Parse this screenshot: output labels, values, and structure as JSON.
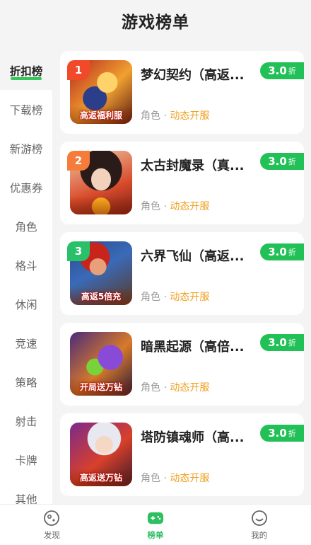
{
  "header": {
    "title": "游戏榜单"
  },
  "sidebar": {
    "items": [
      {
        "label": "折扣榜",
        "active": true
      },
      {
        "label": "下载榜"
      },
      {
        "label": "新游榜"
      },
      {
        "label": "优惠券"
      },
      {
        "label": "角色"
      },
      {
        "label": "格斗"
      },
      {
        "label": "休闲"
      },
      {
        "label": "竞速"
      },
      {
        "label": "策略"
      },
      {
        "label": "射击"
      },
      {
        "label": "卡牌"
      },
      {
        "label": "其他"
      }
    ]
  },
  "games": [
    {
      "rank": "1",
      "name": "梦幻契约（高返...",
      "category": "角色",
      "tag": "动态开服",
      "discount": "3.0",
      "unit": "折",
      "banner": "高返福利服",
      "rank_color": "#f04a2a"
    },
    {
      "rank": "2",
      "name": "太古封魔录（真...",
      "category": "角色",
      "tag": "动态开服",
      "discount": "3.0",
      "unit": "折",
      "banner": "",
      "rank_color": "#f57c3a"
    },
    {
      "rank": "3",
      "name": "六界飞仙（高返...",
      "category": "角色",
      "tag": "动态开服",
      "discount": "3.0",
      "unit": "折",
      "banner": "高返5倍充",
      "rank_color": "#29c06a"
    },
    {
      "rank": "",
      "name": "暗黑起源（高倍...",
      "category": "角色",
      "tag": "动态开服",
      "discount": "3.0",
      "unit": "折",
      "banner": "开局送万钻",
      "rank_color": ""
    },
    {
      "rank": "",
      "name": "塔防镇魂师（高...",
      "category": "角色",
      "tag": "动态开服",
      "discount": "3.0",
      "unit": "折",
      "banner": "高返送万钻",
      "rank_color": ""
    }
  ],
  "meta_separator": " · ",
  "tabbar": {
    "tabs": [
      {
        "label": "发现",
        "icon": "discover-icon"
      },
      {
        "label": "榜单",
        "icon": "ranking-icon",
        "active": true
      },
      {
        "label": "我的",
        "icon": "profile-icon"
      }
    ]
  },
  "colors": {
    "accent": "#22c157",
    "tag": "#f0a020"
  }
}
